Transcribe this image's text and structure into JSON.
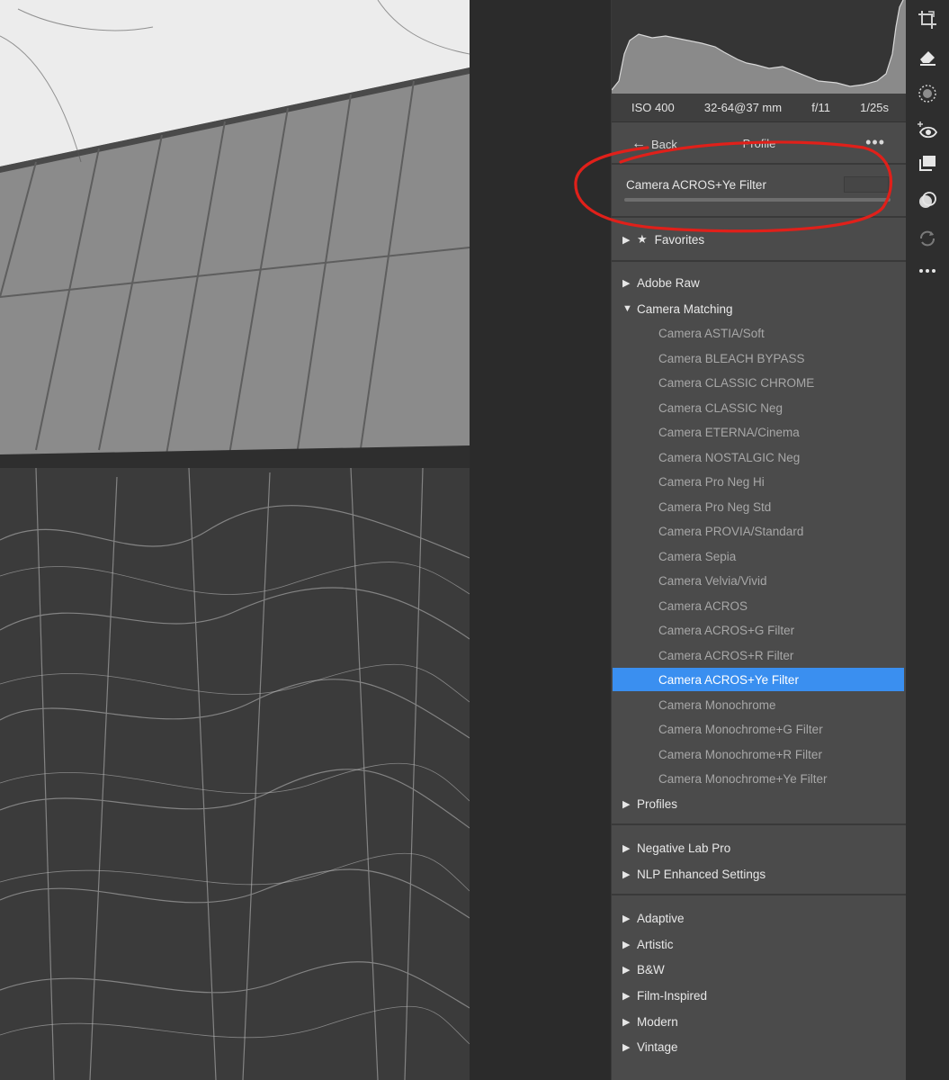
{
  "exif": {
    "iso": "ISO 400",
    "lens": "32-64@37 mm",
    "aperture": "f/11",
    "shutter": "1/25s"
  },
  "profile_header": {
    "back_label": "Back",
    "title": "Profile",
    "more": "•••"
  },
  "current_profile": {
    "name": "Camera ACROS+Ye Filter"
  },
  "groups": {
    "favorites": "Favorites",
    "adobe_raw": "Adobe Raw",
    "camera_matching": "Camera Matching",
    "profiles": "Profiles",
    "negative_lab_pro": "Negative Lab Pro",
    "nlp_enhanced": "NLP Enhanced Settings",
    "adaptive": "Adaptive",
    "artistic": "Artistic",
    "bw": "B&W",
    "film_inspired": "Film-Inspired",
    "modern": "Modern",
    "vintage": "Vintage"
  },
  "camera_matching_items": [
    "Camera ASTIA/Soft",
    "Camera BLEACH BYPASS",
    "Camera CLASSIC CHROME",
    "Camera CLASSIC Neg",
    "Camera ETERNA/Cinema",
    "Camera NOSTALGIC Neg",
    "Camera Pro Neg Hi",
    "Camera Pro Neg Std",
    "Camera PROVIA/Standard",
    "Camera Sepia",
    "Camera Velvia/Vivid",
    "Camera ACROS",
    "Camera ACROS+G Filter",
    "Camera ACROS+R Filter",
    "Camera ACROS+Ye Filter",
    "Camera Monochrome",
    "Camera Monochrome+G Filter",
    "Camera Monochrome+R Filter",
    "Camera Monochrome+Ye Filter"
  ],
  "selected_item_index": 14,
  "colors": {
    "selection": "#3a8ff0",
    "annotation": "#e0201a",
    "panel": "#4b4b4b"
  },
  "toolbar_icons": [
    "crop-icon",
    "eraser-icon",
    "mask-icon",
    "red-eye-icon",
    "presets-icon",
    "snapshots-icon",
    "sync-icon",
    "more-icon"
  ]
}
